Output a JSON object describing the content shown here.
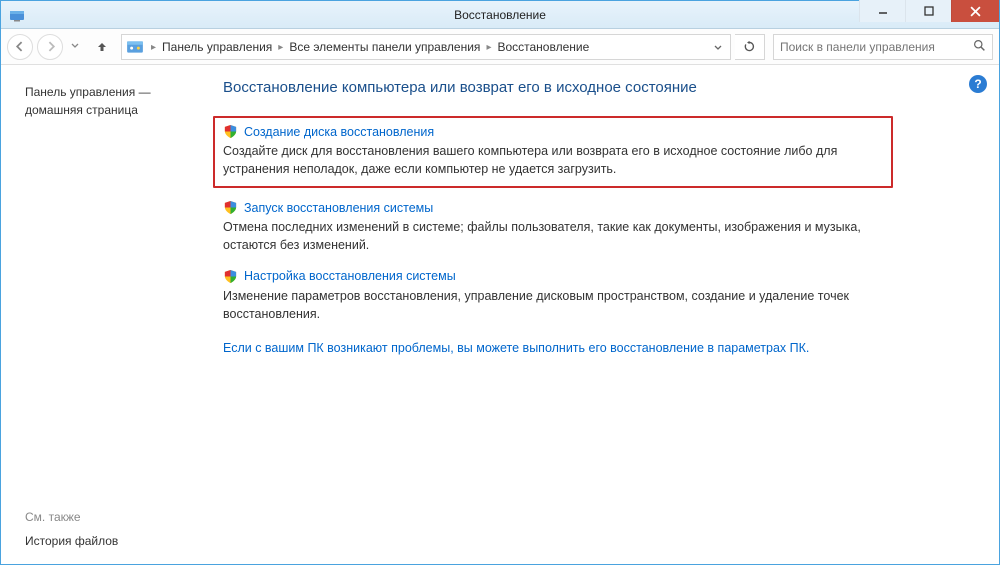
{
  "window": {
    "title": "Восстановление"
  },
  "breadcrumb": {
    "items": [
      "Панель управления",
      "Все элементы панели управления",
      "Восстановление"
    ]
  },
  "search": {
    "placeholder": "Поиск в панели управления"
  },
  "sidebar": {
    "cp_home_line1": "Панель управления —",
    "cp_home_line2": "домашняя страница",
    "see_also_label": "См. также",
    "file_history_label": "История файлов"
  },
  "main": {
    "title": "Восстановление компьютера или возврат его в исходное состояние",
    "options": [
      {
        "link": "Создание диска восстановления",
        "desc": "Создайте диск для восстановления вашего компьютера или возврата его в исходное состояние либо для устранения неполадок, даже если компьютер не удается загрузить."
      },
      {
        "link": "Запуск восстановления системы",
        "desc": "Отмена последних изменений в системе; файлы пользователя, такие как документы, изображения и музыка, остаются без изменений."
      },
      {
        "link": "Настройка восстановления системы",
        "desc": "Изменение параметров восстановления, управление дисковым пространством, создание и удаление точек восстановления."
      }
    ],
    "bottom_link": "Если с вашим ПК возникают проблемы, вы можете выполнить его восстановление в параметрах ПК."
  }
}
